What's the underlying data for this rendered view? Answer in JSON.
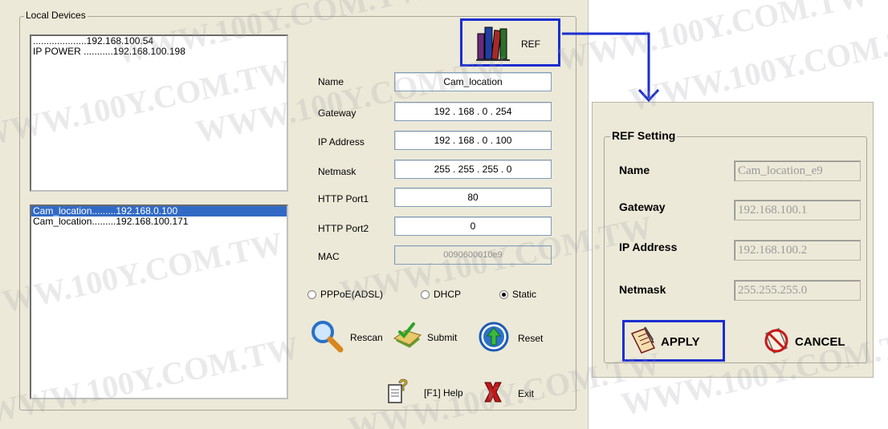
{
  "local_devices": {
    "title": "Local Devices",
    "top_list": [
      "....................192.168.100.54",
      "IP POWER ...........192.168.100.198"
    ],
    "bottom_list": [
      "Cam_location.........192.168.0.100",
      "Cam_location.........192.168.100.171"
    ]
  },
  "form": {
    "name_label": "Name",
    "name_value": "Cam_location",
    "gateway_label": "Gateway",
    "gateway_value": "192 . 168 .   0  . 254",
    "ip_label": "IP Address",
    "ip_value": "192 . 168 .   0  . 100",
    "netmask_label": "Netmask",
    "netmask_value": "255 . 255 . 255 .   0",
    "port1_label": "HTTP Port1",
    "port1_value": "80",
    "port2_label": "HTTP Port2",
    "port2_value": "0",
    "mac_label": "MAC",
    "mac_value": "0090600010e9"
  },
  "radios": {
    "pppoe": "PPPoE(ADSL)",
    "dhcp": "DHCP",
    "static": "Static",
    "selected": "static"
  },
  "buttons": {
    "ref": "REF",
    "rescan": "Rescan",
    "submit": "Submit",
    "reset": "Reset",
    "help": "[F1] Help",
    "exit": "Exit"
  },
  "ref_dialog": {
    "title": "REF Setting",
    "name_label": "Name",
    "name_value": "Cam_location_e9",
    "gateway_label": "Gateway",
    "gateway_value": "192.168.100.1",
    "ip_label": "IP Address",
    "ip_value": "192.168.100.2",
    "netmask_label": "Netmask",
    "netmask_value": "255.255.255.0",
    "apply": "APPLY",
    "cancel": "CANCEL"
  },
  "watermark": "WWW.100Y.COM.TW",
  "colors": {
    "highlight": "#1b2ed1",
    "selection": "#316ac5",
    "window_bg": "#ece9d8"
  },
  "icons": [
    "books-icon",
    "search-icon",
    "pen-check-icon",
    "up-arrow-icon",
    "help-icon",
    "exit-icon",
    "apply-icon",
    "cancel-icon"
  ]
}
